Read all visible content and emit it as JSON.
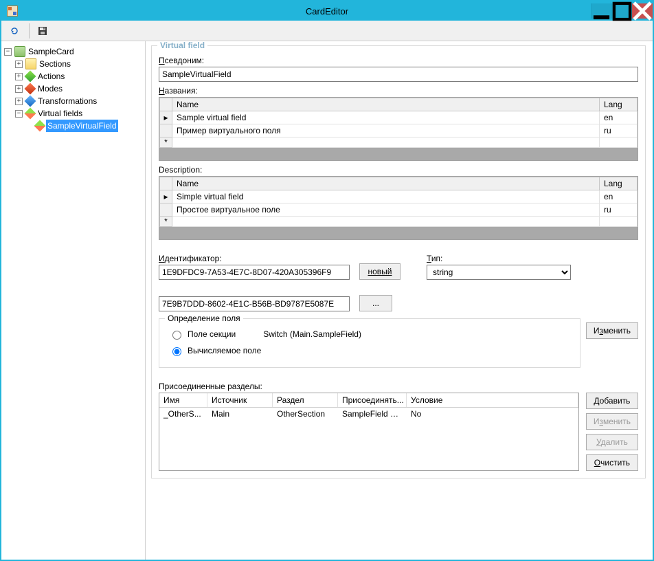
{
  "window": {
    "title": "CardEditor"
  },
  "tree": {
    "root": "SampleCard",
    "items": {
      "sections": "Sections",
      "actions": "Actions",
      "modes": "Modes",
      "transformations": "Transformations",
      "virtual_fields": "Virtual fields",
      "virtual_item": "SampleVirtualField"
    }
  },
  "panel": {
    "title": "Virtual field",
    "alias_label": "Псевдоним:",
    "alias_value": "SampleVirtualField",
    "names_label": "Названия:",
    "names_cols": {
      "name": "Name",
      "lang": "Lang"
    },
    "names_rows": [
      {
        "name": "Sample virtual field",
        "lang": "en"
      },
      {
        "name": "Пример виртуального поля",
        "lang": "ru"
      }
    ],
    "desc_label": "Description:",
    "desc_rows": [
      {
        "name": "Simple virtual field",
        "lang": "en"
      },
      {
        "name": "Простое виртуальное поле",
        "lang": "ru"
      }
    ],
    "id_label": "Идентификатор:",
    "id_value": "1E9DFDC9-7A53-4E7C-8D07-420A305396F9",
    "new_btn": "новый",
    "type_label": "Тип:",
    "type_value": "string",
    "id2_value": "7E9B7DDD-8602-4E1C-B56B-BD9787E5087E",
    "browse_btn": "...",
    "def_group": "Определение поля",
    "radio_section": "Поле секции",
    "radio_calc": "Вычисляемое поле",
    "def_text": "Switch (Main.SampleField)",
    "edit_btn": "Изменить",
    "joined_label": "Присоединенные разделы:",
    "joined_cols": {
      "name": "Имя",
      "source": "Источник",
      "section": "Раздел",
      "join": "Присоединять...",
      "cond": "Условие"
    },
    "joined_rows": [
      {
        "name": "_OtherS...",
        "source": "Main",
        "section": "OtherSection",
        "join": "SampleField = ...",
        "cond": "No"
      }
    ],
    "btn_add": "Добавить",
    "btn_edit2": "Изменить",
    "btn_delete": "Удалить",
    "btn_clear": "Очистить"
  }
}
